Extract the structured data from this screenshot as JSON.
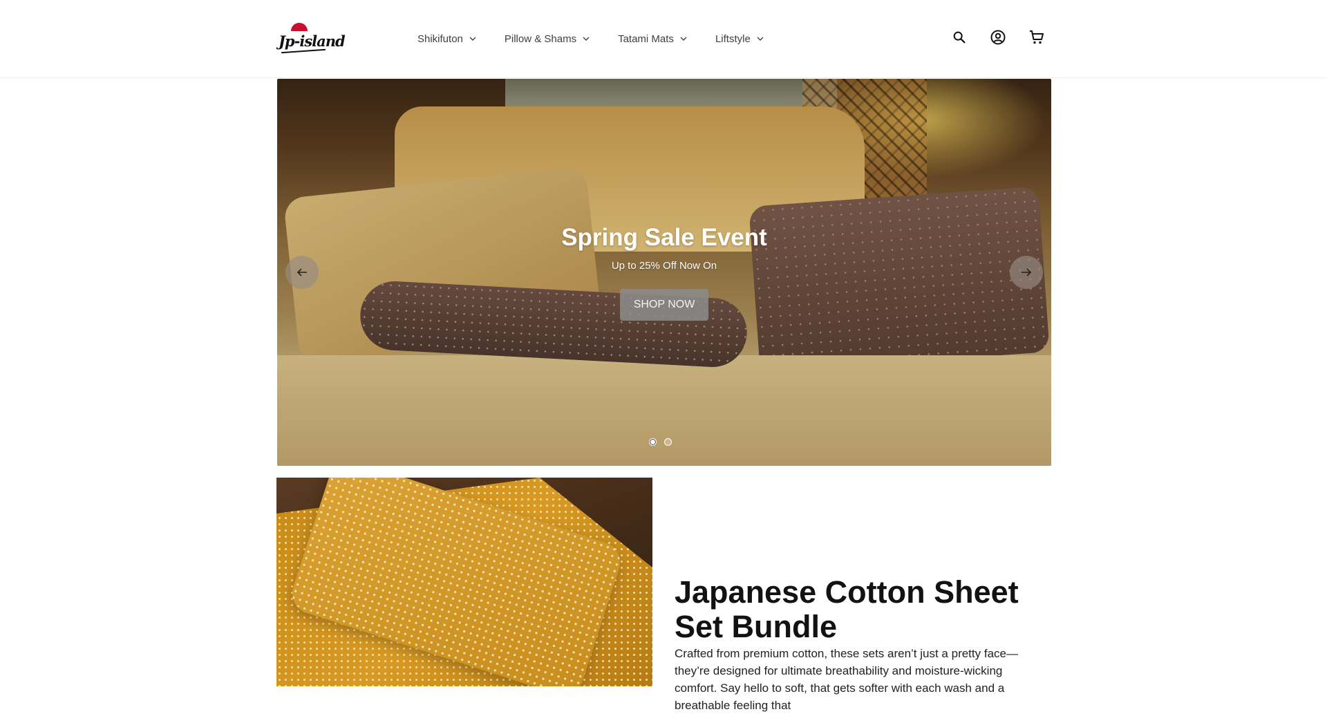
{
  "brand": {
    "logo_text": "Jp-island"
  },
  "nav": {
    "items": [
      {
        "label": "Shikifuton"
      },
      {
        "label": "Pillow & Shams"
      },
      {
        "label": "Tatami Mats"
      },
      {
        "label": "Liftstyle"
      }
    ]
  },
  "header_icons": [
    "search-icon",
    "account-icon",
    "cart-icon"
  ],
  "hero": {
    "title": "Spring Sale Event",
    "subtitle": "Up to 25% Off Now On",
    "button_label": "SHOP NOW",
    "slide_count": 2,
    "active_slide": 1
  },
  "feature": {
    "title": "Japanese Cotton Sheet Set Bundle",
    "text": "Crafted from premium cotton, these sets aren’t just a pretty face—they’re designed for ultimate breathability and moisture-wicking comfort. Say hello to soft, that gets softer with each wash and a breathable feeling that"
  },
  "colors": {
    "text": "#121212",
    "nav_text": "#3f3f3f",
    "button_bg": "#8c8c8c",
    "accent_red": "#c8102e"
  }
}
